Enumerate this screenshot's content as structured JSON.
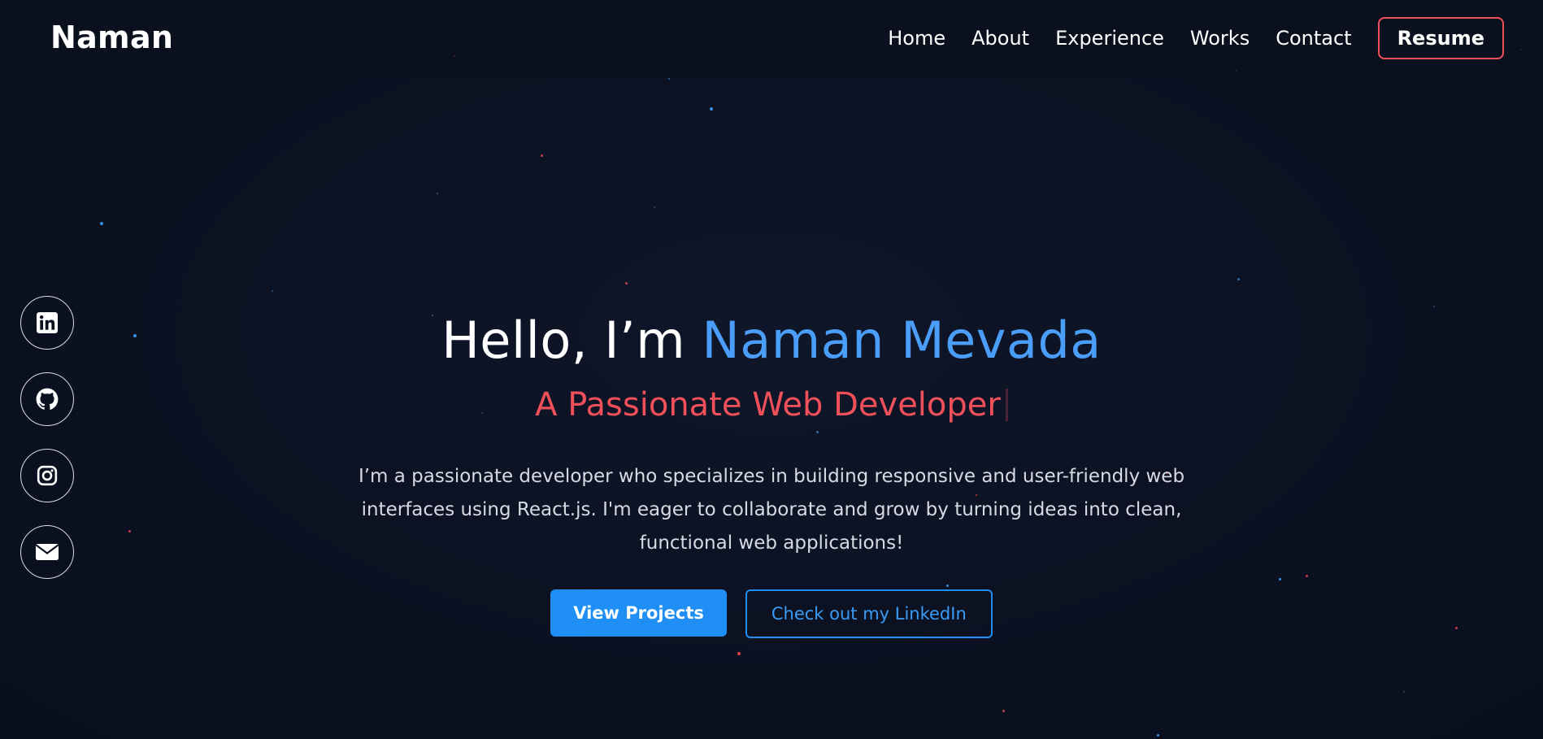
{
  "header": {
    "logo": "Naman",
    "nav": {
      "home": "Home",
      "about": "About",
      "experience": "Experience",
      "works": "Works",
      "contact": "Contact"
    },
    "resume_label": "Resume"
  },
  "social": [
    {
      "name": "linkedin",
      "icon": "linkedin-icon"
    },
    {
      "name": "github",
      "icon": "github-icon"
    },
    {
      "name": "instagram",
      "icon": "instagram-icon"
    },
    {
      "name": "email",
      "icon": "envelope-icon"
    }
  ],
  "hero": {
    "greeting": "Hello, I’m ",
    "name": "Naman Mevada",
    "subtitle": "A Passionate Web Developer",
    "description": "I’m a passionate developer who specializes in building responsive and user-friendly web interfaces using React.js. I'm eager to collaborate and grow by turning ideas into clean, functional web applications!",
    "primary_button": "View Projects",
    "secondary_button": "Check out my LinkedIn"
  },
  "colors": {
    "background": "#0b1121",
    "accent_blue": "#4a9df8",
    "accent_red": "#f0505a",
    "button_blue": "#1f8ff5"
  }
}
